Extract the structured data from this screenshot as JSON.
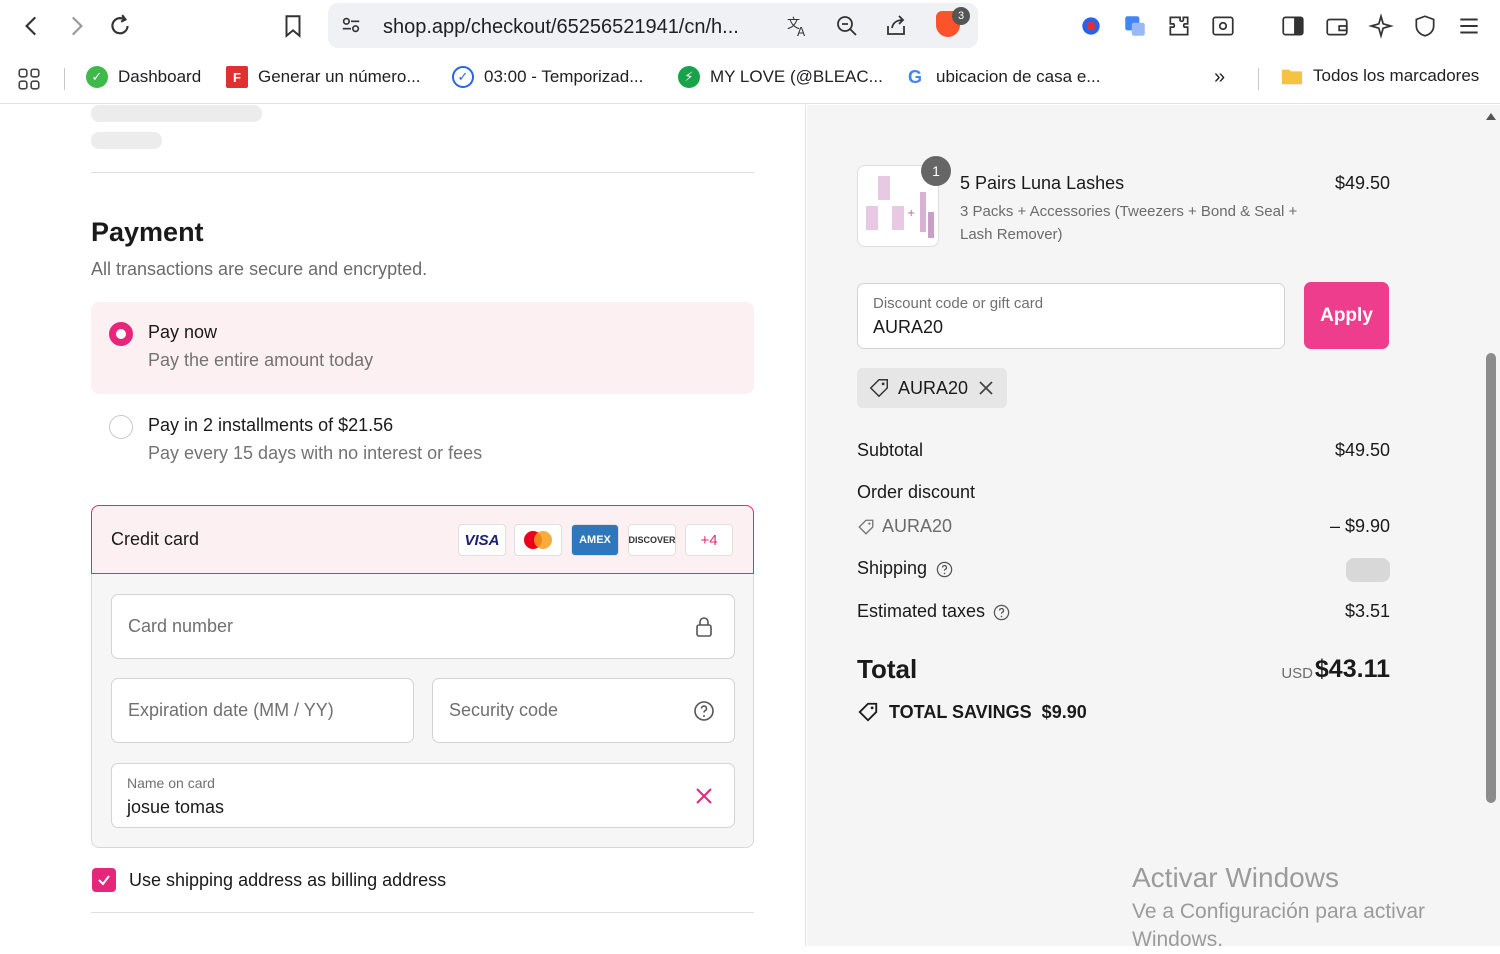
{
  "browser": {
    "url": "shop.app/checkout/65256521941/cn/h...",
    "extension_badge": "3",
    "bookmarks": [
      {
        "label": "Dashboard",
        "icon": "dashboard-favicon",
        "color": "#3fb94a"
      },
      {
        "label": "Generar un número...",
        "icon": "f-favicon",
        "color": "#e03131"
      },
      {
        "label": "03:00 - Temporizad...",
        "icon": "timer-favicon",
        "color": "#2563eb"
      },
      {
        "label": "MY LOVE (@BLEAC...",
        "icon": "bolt-favicon",
        "color": "#16a34a"
      },
      {
        "label": "ubicacion de casa e...",
        "icon": "google-favicon",
        "color": "#4285f4"
      }
    ],
    "all_bookmarks": "Todos los marcadores"
  },
  "payment": {
    "title": "Payment",
    "subtitle": "All transactions are secure and encrypted.",
    "options": [
      {
        "title": "Pay now",
        "desc": "Pay the entire amount today",
        "selected": true
      },
      {
        "title": "Pay in 2 installments of $21.56",
        "desc": "Pay every 15 days with no interest or fees",
        "selected": false
      }
    ],
    "credit_card": {
      "label": "Credit card",
      "brands": [
        "VISA",
        "mastercard",
        "AMEX",
        "DISCOVER"
      ],
      "more": "+4",
      "card_number_placeholder": "Card number",
      "expiration_placeholder": "Expiration date (MM / YY)",
      "security_placeholder": "Security code",
      "name_label": "Name on card",
      "name_value": "josue tomas"
    },
    "billing_checkbox": "Use shipping address as billing address"
  },
  "summary": {
    "item": {
      "quantity": "1",
      "name": "5 Pairs Luna Lashes",
      "variant": "3 Packs + Accessories (Tweezers + Bond & Seal + Lash Remover)",
      "price": "$49.50"
    },
    "discount_label": "Discount code or gift card",
    "discount_value": "AURA20",
    "apply": "Apply",
    "applied_code": "AURA20",
    "subtotal_label": "Subtotal",
    "subtotal": "$49.50",
    "order_discount_label": "Order discount",
    "order_discount_code": "AURA20",
    "order_discount_value": "– $9.90",
    "shipping_label": "Shipping",
    "taxes_label": "Estimated taxes",
    "taxes": "$3.51",
    "total_label": "Total",
    "currency": "USD",
    "total": "$43.11",
    "savings": "TOTAL SAVINGS  $9.90"
  },
  "watermark": {
    "line1": "Activar Windows",
    "line2": "Ve a Configuración para activar Windows."
  },
  "colors": {
    "accent": "#e6267a",
    "apply": "#ee3d8c"
  }
}
